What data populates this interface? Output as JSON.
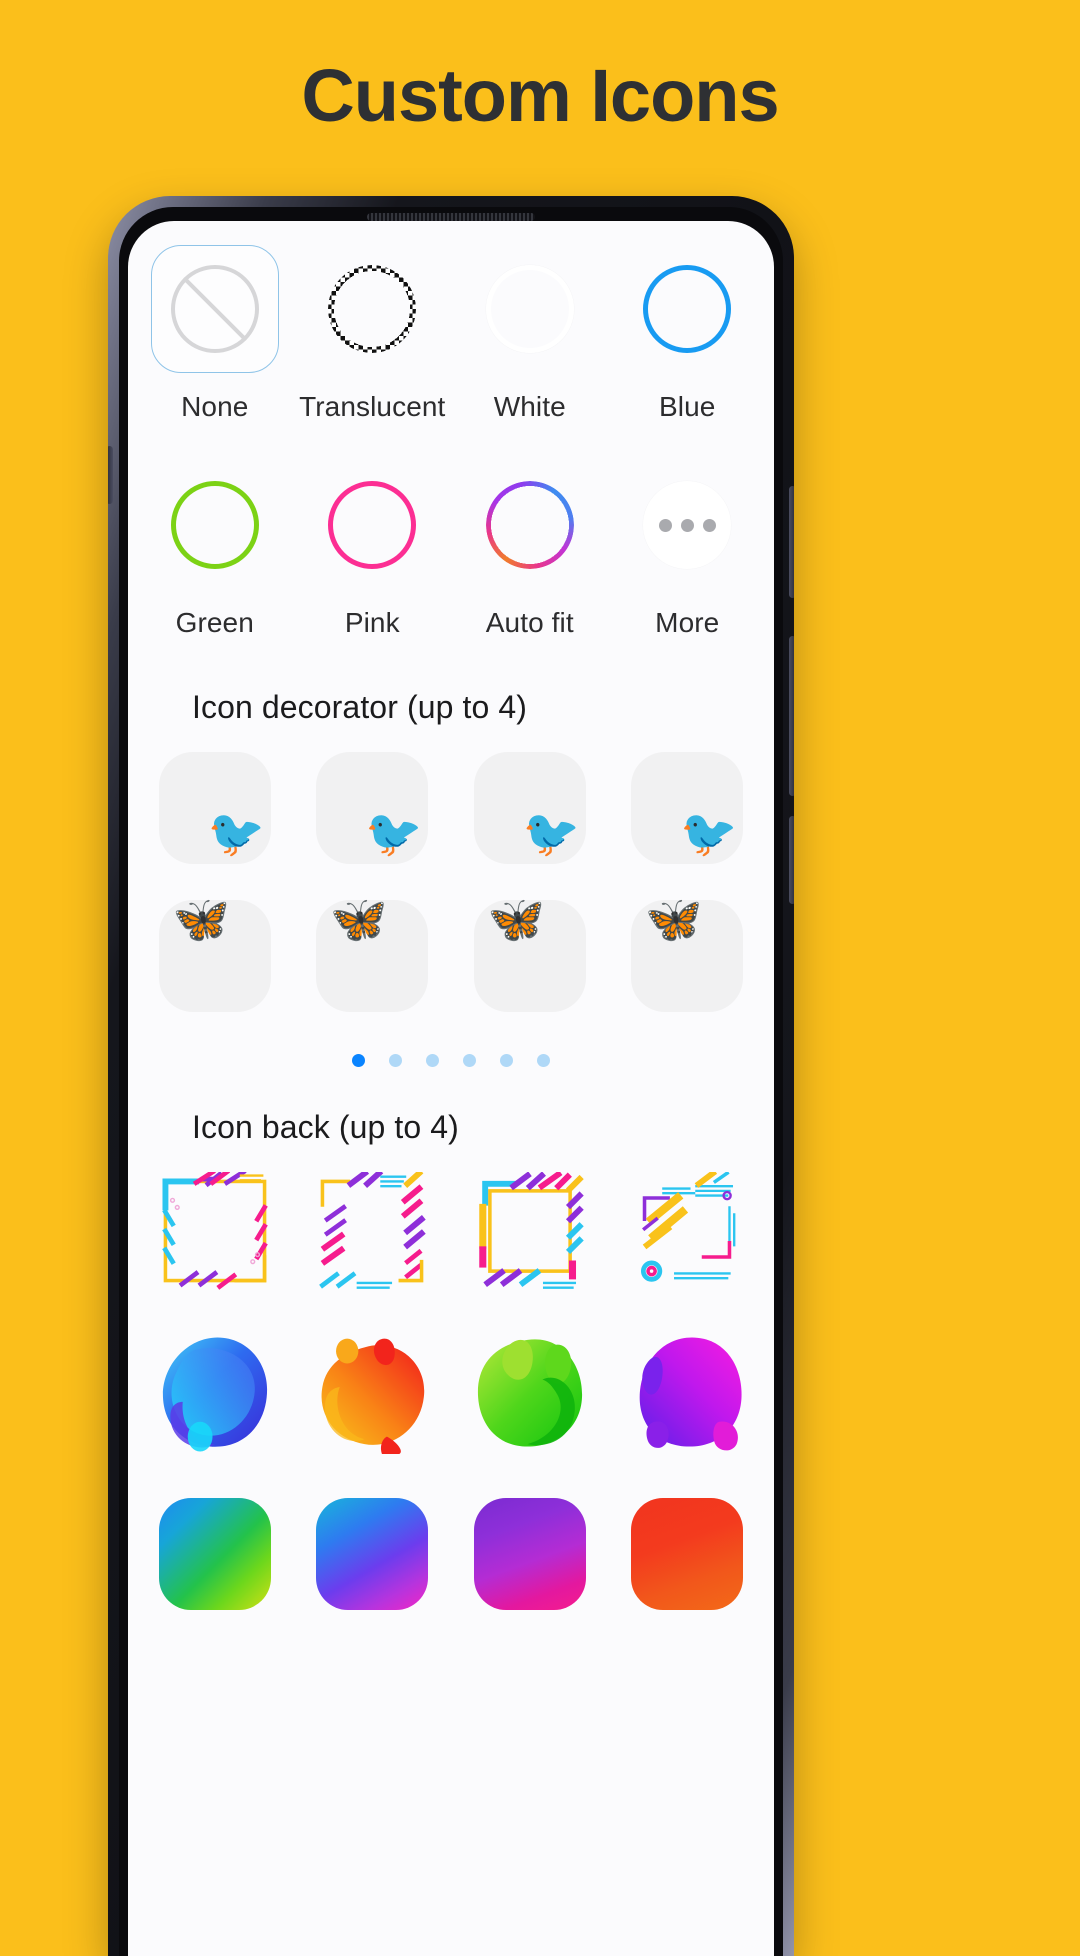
{
  "header": {
    "title": "Custom Icons",
    "background_color": "#FBBF1B",
    "title_color": "#2E3033"
  },
  "screen": {
    "background_color": "#FBFBFD"
  },
  "icon_shape": {
    "options": [
      {
        "label": "None",
        "icon": "prohibited-circle-icon",
        "color": "#D6D6D8",
        "selected": true
      },
      {
        "label": "Translucent",
        "icon": "checkered-ring-icon",
        "color": "#111111",
        "selected": false
      },
      {
        "label": "White",
        "icon": "white-ring-icon",
        "color": "#FFFFFF",
        "selected": false
      },
      {
        "label": "Blue",
        "icon": "blue-ring-icon",
        "color": "#189BF2",
        "selected": false
      },
      {
        "label": "Green",
        "icon": "green-ring-icon",
        "color": "#7CD215",
        "selected": false
      },
      {
        "label": "Pink",
        "icon": "pink-ring-icon",
        "color": "#FC2E93",
        "selected": false
      },
      {
        "label": "Auto fit",
        "icon": "gradient-ring-icon",
        "color": "#A734E8",
        "selected": false
      },
      {
        "label": "More",
        "icon": "more-dots-icon",
        "color": "#A9AAAE",
        "selected": false
      }
    ]
  },
  "icon_decorator": {
    "title": "Icon decorator (up to 4)",
    "items": [
      {
        "name": "cardinal-bird",
        "glyph": "🐦",
        "color": "#E2231A"
      },
      {
        "name": "kingfisher-bird",
        "glyph": "🐦",
        "color": "#1A9FD4"
      },
      {
        "name": "sparrow-bird",
        "glyph": "🐦",
        "color": "#8B5E3C"
      },
      {
        "name": "tit-bird",
        "glyph": "🐦",
        "color": "#F2C12E"
      },
      {
        "name": "monarch-butterfly",
        "glyph": "🦋",
        "color": "#E8A020"
      },
      {
        "name": "blue-butterfly",
        "glyph": "🦋",
        "color": "#1F8FBF"
      },
      {
        "name": "pink-butterfly",
        "glyph": "🦋",
        "color": "#F0A8D8"
      },
      {
        "name": "red-butterfly",
        "glyph": "🦋",
        "color": "#D9332B"
      }
    ],
    "pagination": {
      "total": 6,
      "active_index": 0,
      "active_color": "#0A84FF",
      "inactive_color": "#AFD8F7"
    }
  },
  "icon_back": {
    "title": "Icon back (up to 4)",
    "frames": [
      {
        "name": "memphis-frame-1"
      },
      {
        "name": "memphis-frame-2"
      },
      {
        "name": "memphis-frame-3"
      },
      {
        "name": "memphis-frame-4"
      }
    ],
    "blobs": [
      {
        "name": "blob-blue",
        "color_from": "#3BC8F5",
        "color_to": "#3A35E0"
      },
      {
        "name": "blob-orange",
        "color_from": "#F9A81B",
        "color_to": "#F31C1C"
      },
      {
        "name": "blob-green",
        "color_from": "#A8E038",
        "color_to": "#12C90E"
      },
      {
        "name": "blob-magenta",
        "color_from": "#F31CD8",
        "color_to": "#6B20E8"
      }
    ],
    "squircles": [
      {
        "name": "squircle-blue-green",
        "color_from": "#1E8BF0",
        "color_to": "#D2E016"
      },
      {
        "name": "squircle-cyan-magenta",
        "color_from": "#18B5DA",
        "color_to": "#F425C4"
      },
      {
        "name": "squircle-purple-pink",
        "color_from": "#7B2BD1",
        "color_to": "#F61C8D"
      },
      {
        "name": "squircle-red-orange",
        "color_from": "#F2341F",
        "color_to": "#F36A18"
      }
    ]
  }
}
